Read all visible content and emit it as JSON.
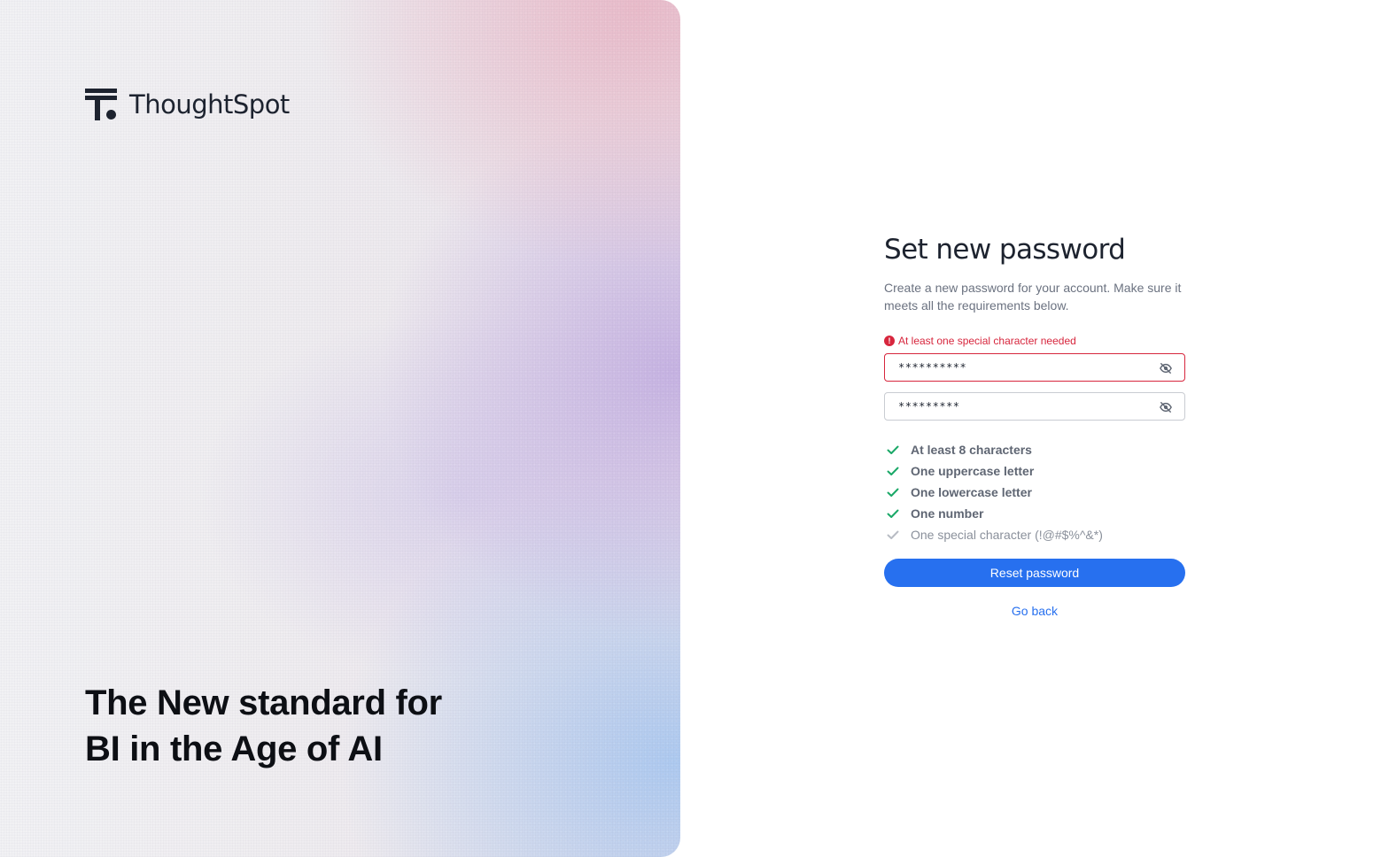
{
  "brand": {
    "name": "ThoughtSpot"
  },
  "hero": {
    "tagline_line1": "The New standard for",
    "tagline_line2": "BI in the Age of AI"
  },
  "form": {
    "title": "Set new password",
    "description": "Create a new password for your account. Make sure it meets all the requirements below.",
    "error_message": "At least one special character needed",
    "new_password_value": "**********",
    "confirm_password_value": "*********",
    "requirements": [
      {
        "label": "At least 8 characters",
        "met": true
      },
      {
        "label": "One uppercase letter",
        "met": true
      },
      {
        "label": "One lowercase letter",
        "met": true
      },
      {
        "label": "One number",
        "met": true
      },
      {
        "label": "One special character (!@#$%^&*)",
        "met": false
      }
    ],
    "submit_label": "Reset password",
    "back_label": "Go back"
  },
  "colors": {
    "accent": "#2770ef",
    "error": "#d7263d",
    "check_met": "#1aa867",
    "check_pending": "#b8bcc4"
  },
  "icons": [
    "thoughtspot-logo-icon",
    "error-icon",
    "eye-off-icon",
    "check-icon"
  ]
}
